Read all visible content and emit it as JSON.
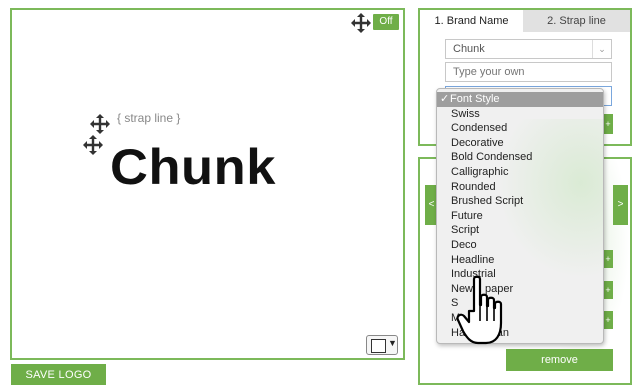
{
  "canvas": {
    "off_toggle": "Off",
    "strap_line": "{ strap line }",
    "brand_text": "Chunk"
  },
  "save_logo": "SAVE LOGO",
  "tabs": [
    {
      "label": "1. Brand Name"
    },
    {
      "label": "2. Strap line"
    }
  ],
  "brand_select": {
    "value": "Chunk"
  },
  "custom_input": {
    "placeholder": "Type your own"
  },
  "font_dropdown": {
    "options": [
      "Font Style",
      "Swiss",
      "Condensed",
      "Decorative",
      "Bold Condensed",
      "Calligraphic",
      "Rounded",
      "Brushed Script",
      "Future",
      "Script",
      "Deco",
      "Headline",
      "Industrial",
      "Newspaper",
      "St",
      "M",
      "Handwritten"
    ],
    "visible_labels": [
      "Font Style",
      "Swiss",
      "Condensed",
      "Decorative",
      "Bold Condensed",
      "Calligraphic",
      "Rounded",
      "Brushed Script",
      "Future",
      "Script",
      "Deco",
      "Headline",
      "Industrial",
      "New",
      "paper",
      "S",
      "M",
      "Har",
      "an"
    ],
    "selected": "Font Style",
    "check": "✓"
  },
  "arrows": {
    "left": "<",
    "right": ">"
  },
  "plus": "+",
  "remove_button": "remove",
  "accent_color": "#6fae48",
  "icons": [
    "move-arrows-icon",
    "color-swatch-icon",
    "hand-pointer-icon"
  ]
}
